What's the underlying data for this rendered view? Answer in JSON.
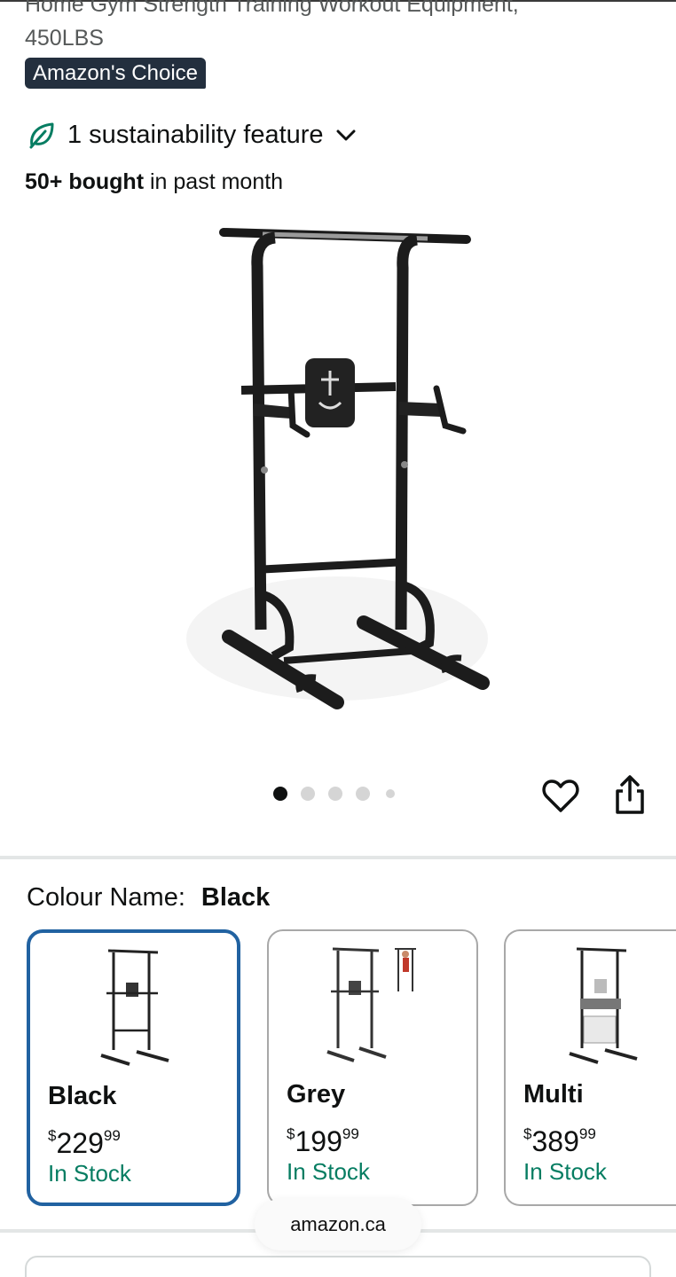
{
  "product": {
    "title_line1": "Home Gym Strength Training Workout Equipment,",
    "title_line2": "450LBS",
    "badge": "Amazon's Choice",
    "sustainability_label": "1 sustainability feature",
    "bought_bold": "50+ bought",
    "bought_rest": " in past month",
    "carousel": {
      "total_dots": 5,
      "active_index": 0
    }
  },
  "colours": {
    "label": "Colour Name:",
    "selected": "Black",
    "options": [
      {
        "name": "Black",
        "currency": "$",
        "price_whole": "229",
        "price_fraction": "99",
        "stock": "In Stock"
      },
      {
        "name": "Grey",
        "currency": "$",
        "price_whole": "199",
        "price_fraction": "99",
        "stock": "In Stock"
      },
      {
        "name": "Multi",
        "currency": "$",
        "price_whole": "389",
        "price_fraction": "99",
        "stock": "In Stock"
      }
    ]
  },
  "browser": {
    "url": "amazon.ca"
  },
  "colors": {
    "badge_bg": "#232f3e",
    "in_stock": "#067d62",
    "selected_border": "#2162a1",
    "leaf": "#067d62"
  }
}
